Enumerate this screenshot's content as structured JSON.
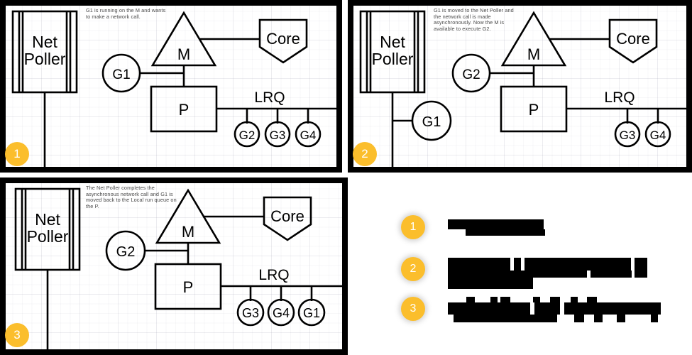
{
  "diagram": {
    "shared_labels": {
      "net_poller": "Net\nPoller",
      "m": "M",
      "p": "P",
      "core": "Core",
      "lrq": "LRQ"
    },
    "panels": [
      {
        "step": "1",
        "note": "G1 is running on the M and wants to make a network call.",
        "goroutine_on_m": "G1",
        "netpoller_goroutine": null,
        "lrq_goroutines": [
          "G2",
          "G3",
          "G4"
        ]
      },
      {
        "step": "2",
        "note": "G1 is moved to the Net Poller and the network call is made asynchronously. Now the M is available to execute G2.",
        "goroutine_on_m": "G2",
        "netpoller_goroutine": "G1",
        "lrq_goroutines": [
          "G3",
          "G4"
        ]
      },
      {
        "step": "3",
        "note": "The Net Poller completes the asynchronous network call and G1 is moved back to the Local run queue on the P.",
        "goroutine_on_m": "G2",
        "netpoller_goroutine": null,
        "lrq_goroutines": [
          "G3",
          "G4",
          "G1"
        ]
      }
    ]
  },
  "legend": {
    "items": [
      {
        "step": "1",
        "redacted": true,
        "lines": 1
      },
      {
        "step": "2",
        "redacted": true,
        "lines": 2
      },
      {
        "step": "3",
        "redacted": true,
        "lines": 1
      }
    ]
  },
  "colors": {
    "badge": "#FBBE2C",
    "badge_text": "#FFFFFF",
    "panel_border": "#000000",
    "stroke": "#000000",
    "note_text": "#4A4A4A",
    "panel_background": "#FFFFFF",
    "redaction": "#000000"
  }
}
